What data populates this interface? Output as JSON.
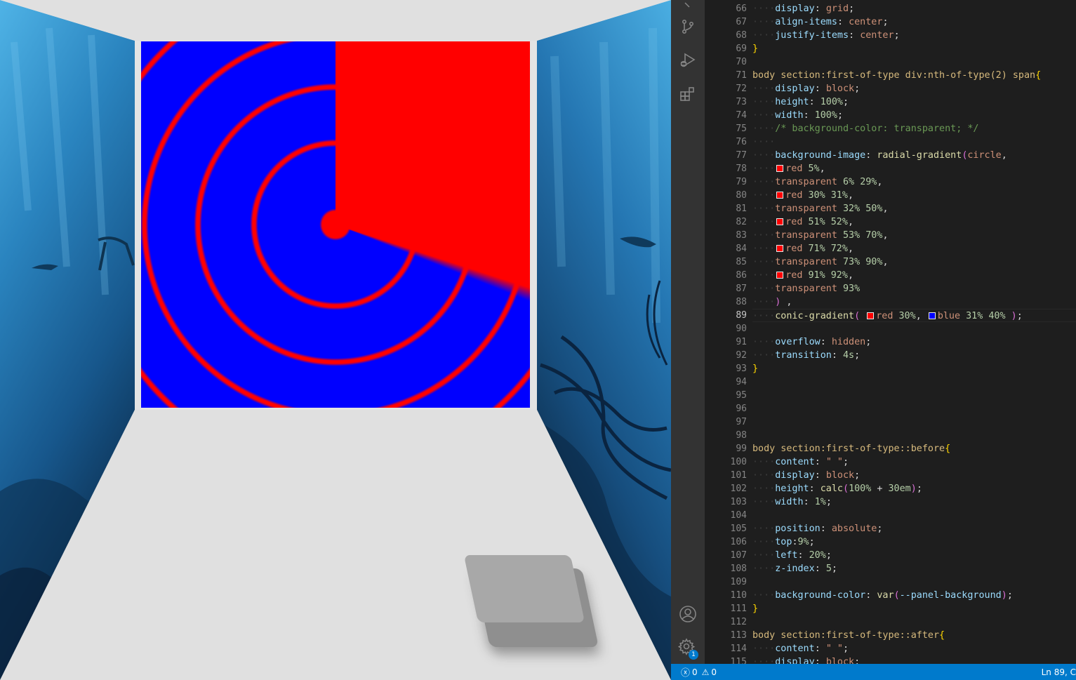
{
  "colors": {
    "floor": "#e0e0e0",
    "water_light": "#3a9fd6",
    "water_dark": "#0c2c4c",
    "editor_bg": "#1e1e1e",
    "activity_bar": "#333333",
    "status_bar": "#007acc"
  },
  "activity_bar": {
    "icons": [
      "source-control-icon",
      "run-debug-icon",
      "extensions-icon",
      "account-icon",
      "manage-gear-icon"
    ],
    "settings_badge": "1"
  },
  "editor": {
    "active_line": 89,
    "lines": [
      {
        "n": 66,
        "t": [
          [
            "ws",
            "····"
          ],
          [
            "prop",
            "display"
          ],
          [
            "pn",
            ": "
          ],
          [
            "val",
            "grid"
          ],
          [
            "pn",
            ";"
          ]
        ]
      },
      {
        "n": 67,
        "t": [
          [
            "ws",
            "····"
          ],
          [
            "prop",
            "align-items"
          ],
          [
            "pn",
            ": "
          ],
          [
            "val",
            "center"
          ],
          [
            "pn",
            ";"
          ]
        ]
      },
      {
        "n": 68,
        "t": [
          [
            "ws",
            "····"
          ],
          [
            "prop",
            "justify-items"
          ],
          [
            "pn",
            ": "
          ],
          [
            "val",
            "center"
          ],
          [
            "pn",
            ";"
          ]
        ]
      },
      {
        "n": 69,
        "t": [
          [
            "br1",
            "}"
          ]
        ]
      },
      {
        "n": 70,
        "t": []
      },
      {
        "n": 71,
        "t": [
          [
            "sel",
            "body section:first-of-type div:nth-of-type(2) span"
          ],
          [
            "br1",
            "{"
          ]
        ]
      },
      {
        "n": 72,
        "t": [
          [
            "ws",
            "····"
          ],
          [
            "prop",
            "display"
          ],
          [
            "pn",
            ": "
          ],
          [
            "val",
            "block"
          ],
          [
            "pn",
            ";"
          ]
        ]
      },
      {
        "n": 73,
        "t": [
          [
            "ws",
            "····"
          ],
          [
            "prop",
            "height"
          ],
          [
            "pn",
            ": "
          ],
          [
            "num",
            "100%"
          ],
          [
            "pn",
            ";"
          ]
        ]
      },
      {
        "n": 74,
        "t": [
          [
            "ws",
            "····"
          ],
          [
            "prop",
            "width"
          ],
          [
            "pn",
            ": "
          ],
          [
            "num",
            "100%"
          ],
          [
            "pn",
            ";"
          ]
        ]
      },
      {
        "n": 75,
        "t": [
          [
            "ws",
            "····"
          ],
          [
            "cm",
            "/* background-color: transparent; */"
          ]
        ]
      },
      {
        "n": 76,
        "t": [
          [
            "ws",
            "····"
          ]
        ]
      },
      {
        "n": 77,
        "t": [
          [
            "ws",
            "····"
          ],
          [
            "prop",
            "background-image"
          ],
          [
            "pn",
            ": "
          ],
          [
            "fn",
            "radial-gradient"
          ],
          [
            "br2",
            "("
          ],
          [
            "val",
            "circle"
          ],
          [
            "pn",
            ","
          ]
        ]
      },
      {
        "n": 78,
        "t": [
          [
            "ws",
            "····"
          ],
          [
            "sw",
            "#ff0000"
          ],
          [
            "val",
            "red"
          ],
          [
            "pn",
            " "
          ],
          [
            "num",
            "5%"
          ],
          [
            "pn",
            ","
          ]
        ]
      },
      {
        "n": 79,
        "t": [
          [
            "ws",
            "····"
          ],
          [
            "val",
            "transparent"
          ],
          [
            "pn",
            " "
          ],
          [
            "num",
            "6%"
          ],
          [
            "pn",
            " "
          ],
          [
            "num",
            "29%"
          ],
          [
            "pn",
            ","
          ]
        ]
      },
      {
        "n": 80,
        "t": [
          [
            "ws",
            "····"
          ],
          [
            "sw",
            "#ff0000"
          ],
          [
            "val",
            "red"
          ],
          [
            "pn",
            " "
          ],
          [
            "num",
            "30%"
          ],
          [
            "pn",
            " "
          ],
          [
            "num",
            "31%"
          ],
          [
            "pn",
            ","
          ]
        ]
      },
      {
        "n": 81,
        "t": [
          [
            "ws",
            "····"
          ],
          [
            "val",
            "transparent"
          ],
          [
            "pn",
            " "
          ],
          [
            "num",
            "32%"
          ],
          [
            "pn",
            " "
          ],
          [
            "num",
            "50%"
          ],
          [
            "pn",
            ","
          ]
        ]
      },
      {
        "n": 82,
        "t": [
          [
            "ws",
            "····"
          ],
          [
            "sw",
            "#ff0000"
          ],
          [
            "val",
            "red"
          ],
          [
            "pn",
            " "
          ],
          [
            "num",
            "51%"
          ],
          [
            "pn",
            " "
          ],
          [
            "num",
            "52%"
          ],
          [
            "pn",
            ","
          ]
        ]
      },
      {
        "n": 83,
        "t": [
          [
            "ws",
            "····"
          ],
          [
            "val",
            "transparent"
          ],
          [
            "pn",
            " "
          ],
          [
            "num",
            "53%"
          ],
          [
            "pn",
            " "
          ],
          [
            "num",
            "70%"
          ],
          [
            "pn",
            ","
          ]
        ]
      },
      {
        "n": 84,
        "t": [
          [
            "ws",
            "····"
          ],
          [
            "sw",
            "#ff0000"
          ],
          [
            "val",
            "red"
          ],
          [
            "pn",
            " "
          ],
          [
            "num",
            "71%"
          ],
          [
            "pn",
            " "
          ],
          [
            "num",
            "72%"
          ],
          [
            "pn",
            ","
          ]
        ]
      },
      {
        "n": 85,
        "t": [
          [
            "ws",
            "····"
          ],
          [
            "val",
            "transparent"
          ],
          [
            "pn",
            " "
          ],
          [
            "num",
            "73%"
          ],
          [
            "pn",
            " "
          ],
          [
            "num",
            "90%"
          ],
          [
            "pn",
            ","
          ]
        ]
      },
      {
        "n": 86,
        "t": [
          [
            "ws",
            "····"
          ],
          [
            "sw",
            "#ff0000"
          ],
          [
            "val",
            "red"
          ],
          [
            "pn",
            " "
          ],
          [
            "num",
            "91%"
          ],
          [
            "pn",
            " "
          ],
          [
            "num",
            "92%"
          ],
          [
            "pn",
            ","
          ]
        ]
      },
      {
        "n": 87,
        "t": [
          [
            "ws",
            "····"
          ],
          [
            "val",
            "transparent"
          ],
          [
            "pn",
            " "
          ],
          [
            "num",
            "93%"
          ]
        ]
      },
      {
        "n": 88,
        "t": [
          [
            "ws",
            "····"
          ],
          [
            "br2",
            ")"
          ],
          [
            "pn",
            " ,"
          ]
        ]
      },
      {
        "n": 89,
        "t": [
          [
            "ws",
            "····"
          ],
          [
            "fn",
            "conic-gradient"
          ],
          [
            "br2",
            "("
          ],
          [
            "pn",
            " "
          ],
          [
            "sw",
            "#ff0000"
          ],
          [
            "val",
            "red"
          ],
          [
            "pn",
            " "
          ],
          [
            "num",
            "30%"
          ],
          [
            "pn",
            ", "
          ],
          [
            "sw",
            "#0000ff"
          ],
          [
            "val",
            "blue"
          ],
          [
            "pn",
            " "
          ],
          [
            "num",
            "31%"
          ],
          [
            "pn",
            " "
          ],
          [
            "num",
            "40%"
          ],
          [
            "pn",
            " "
          ],
          [
            "br2",
            ")"
          ],
          [
            "pn",
            ";"
          ]
        ]
      },
      {
        "n": 90,
        "t": []
      },
      {
        "n": 91,
        "t": [
          [
            "ws",
            "····"
          ],
          [
            "prop",
            "overflow"
          ],
          [
            "pn",
            ": "
          ],
          [
            "val",
            "hidden"
          ],
          [
            "pn",
            ";"
          ]
        ]
      },
      {
        "n": 92,
        "t": [
          [
            "ws",
            "····"
          ],
          [
            "prop",
            "transition"
          ],
          [
            "pn",
            ": "
          ],
          [
            "num",
            "4s"
          ],
          [
            "pn",
            ";"
          ]
        ]
      },
      {
        "n": 93,
        "t": [
          [
            "br1",
            "}"
          ]
        ]
      },
      {
        "n": 94,
        "t": []
      },
      {
        "n": 95,
        "t": []
      },
      {
        "n": 96,
        "t": []
      },
      {
        "n": 97,
        "t": []
      },
      {
        "n": 98,
        "t": []
      },
      {
        "n": 99,
        "t": [
          [
            "sel",
            "body section:first-of-type::before"
          ],
          [
            "br1",
            "{"
          ]
        ]
      },
      {
        "n": 100,
        "t": [
          [
            "ws",
            "····"
          ],
          [
            "prop",
            "content"
          ],
          [
            "pn",
            ": "
          ],
          [
            "val",
            "\" \""
          ],
          [
            "pn",
            ";"
          ]
        ]
      },
      {
        "n": 101,
        "t": [
          [
            "ws",
            "····"
          ],
          [
            "prop",
            "display"
          ],
          [
            "pn",
            ": "
          ],
          [
            "val",
            "block"
          ],
          [
            "pn",
            ";"
          ]
        ]
      },
      {
        "n": 102,
        "t": [
          [
            "ws",
            "····"
          ],
          [
            "prop",
            "height"
          ],
          [
            "pn",
            ": "
          ],
          [
            "fn",
            "calc"
          ],
          [
            "br2",
            "("
          ],
          [
            "num",
            "100%"
          ],
          [
            "pn",
            " + "
          ],
          [
            "num",
            "30em"
          ],
          [
            "br2",
            ")"
          ],
          [
            "pn",
            ";"
          ]
        ]
      },
      {
        "n": 103,
        "t": [
          [
            "ws",
            "····"
          ],
          [
            "prop",
            "width"
          ],
          [
            "pn",
            ": "
          ],
          [
            "num",
            "1%"
          ],
          [
            "pn",
            ";"
          ]
        ]
      },
      {
        "n": 104,
        "t": []
      },
      {
        "n": 105,
        "t": [
          [
            "ws",
            "····"
          ],
          [
            "prop",
            "position"
          ],
          [
            "pn",
            ": "
          ],
          [
            "val",
            "absolute"
          ],
          [
            "pn",
            ";"
          ]
        ]
      },
      {
        "n": 106,
        "t": [
          [
            "ws",
            "····"
          ],
          [
            "prop",
            "top"
          ],
          [
            "pn",
            ":"
          ],
          [
            "num",
            "9%"
          ],
          [
            "pn",
            ";"
          ]
        ]
      },
      {
        "n": 107,
        "t": [
          [
            "ws",
            "····"
          ],
          [
            "prop",
            "left"
          ],
          [
            "pn",
            ": "
          ],
          [
            "num",
            "20%"
          ],
          [
            "pn",
            ";"
          ]
        ]
      },
      {
        "n": 108,
        "t": [
          [
            "ws",
            "····"
          ],
          [
            "prop",
            "z-index"
          ],
          [
            "pn",
            ": "
          ],
          [
            "num",
            "5"
          ],
          [
            "pn",
            ";"
          ]
        ]
      },
      {
        "n": 109,
        "t": []
      },
      {
        "n": 110,
        "t": [
          [
            "ws",
            "····"
          ],
          [
            "prop",
            "background-color"
          ],
          [
            "pn",
            ": "
          ],
          [
            "fn",
            "var"
          ],
          [
            "br2",
            "("
          ],
          [
            "prop",
            "--panel-background"
          ],
          [
            "br2",
            ")"
          ],
          [
            "pn",
            ";"
          ]
        ]
      },
      {
        "n": 111,
        "t": [
          [
            "br1",
            "}"
          ]
        ]
      },
      {
        "n": 112,
        "t": []
      },
      {
        "n": 113,
        "t": [
          [
            "sel",
            "body section:first-of-type::after"
          ],
          [
            "br1",
            "{"
          ]
        ]
      },
      {
        "n": 114,
        "t": [
          [
            "ws",
            "····"
          ],
          [
            "prop",
            "content"
          ],
          [
            "pn",
            ": "
          ],
          [
            "val",
            "\" \""
          ],
          [
            "pn",
            ";"
          ]
        ]
      },
      {
        "n": 115,
        "t": [
          [
            "ws",
            "····"
          ],
          [
            "prop",
            "display"
          ],
          [
            "pn",
            ": "
          ],
          [
            "val",
            "block"
          ],
          [
            "pn",
            ";"
          ]
        ]
      }
    ]
  },
  "status_bar": {
    "errors": "0",
    "warnings": "0",
    "cursor": "Ln 89, C"
  }
}
